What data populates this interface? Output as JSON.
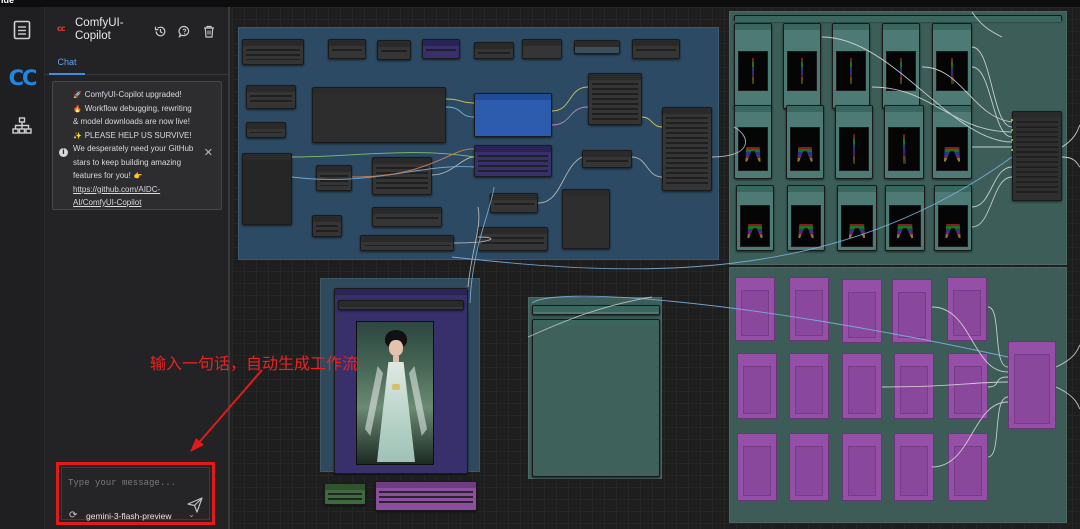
{
  "window": {
    "title": "lde"
  },
  "copilot": {
    "title": "ComfyUI-Copilot",
    "tab_chat": "Chat",
    "notice": {
      "line1": "ComfyUI-Copilot upgraded!",
      "line2": "Workflow debugging, rewriting",
      "line3": "& model downloads are now live!",
      "line4": "PLEASE HELP US SURVIVE!",
      "line5": "We desperately need your GitHub",
      "line6": "stars to keep building amazing",
      "line7": "features for you!",
      "link1": "https://github.com/AIDC-",
      "link2": "AI/ComfyUI-Copilot"
    },
    "input_placeholder": "Type your message...",
    "model": "gemini-3-flash-preview"
  },
  "annotation_text": "输入一句话，自动生成工作流",
  "colors": {
    "accent": "#1e88e5",
    "annotation_red": "#e01b1b",
    "group_blue": "#2c4a63",
    "group_teal": "#3d5e58",
    "node_purple": "#9a4fab"
  },
  "icons": {
    "rail": [
      "document-icon",
      "comfyui-copilot-logo",
      "sitemap-icon"
    ],
    "header": [
      "history-icon",
      "chat-bubble-icon",
      "trash-icon"
    ]
  }
}
